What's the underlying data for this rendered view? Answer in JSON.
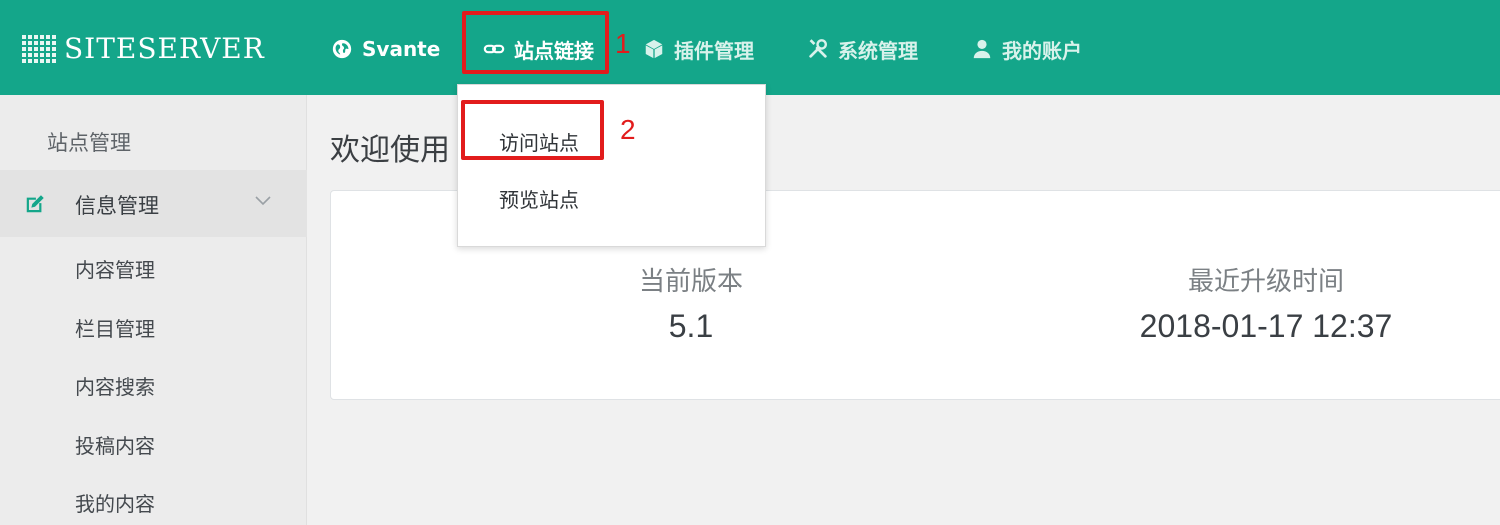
{
  "brand": {
    "name": "SITESERVER"
  },
  "nav": {
    "site": "Svante",
    "links": "站点链接",
    "plugins": "插件管理",
    "system": "系统管理",
    "account": "我的账户"
  },
  "markers": {
    "one": "1",
    "two": "2"
  },
  "dropdown": {
    "visit": "访问站点",
    "preview": "预览站点"
  },
  "sidebar": {
    "title": "站点管理",
    "group": "信息管理",
    "items": [
      "内容管理",
      "栏目管理",
      "内容搜索",
      "投稿内容",
      "我的内容"
    ]
  },
  "main": {
    "title": "欢迎使用",
    "version_label": "当前版本",
    "version_value": "5.1",
    "upgrade_label": "最近升级时间",
    "upgrade_value": "2018-01-17 12:37"
  },
  "colors": {
    "header": "#14a68a",
    "highlight": "#e21c1c",
    "sidebar": "#ececec"
  }
}
